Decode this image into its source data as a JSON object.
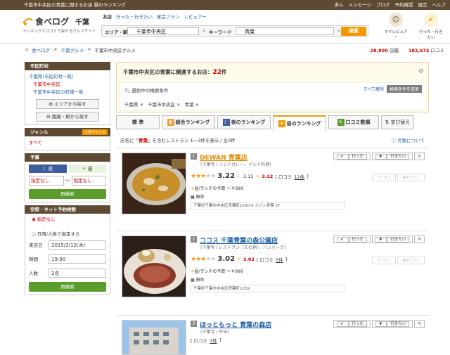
{
  "topbar": {
    "description": "千葉市中央区の青葉に関するお店 昼のランキング",
    "user": "多ム",
    "nav": [
      "メッセージ",
      "ブログ",
      "予約確認",
      "設定",
      "ヘルプ"
    ]
  },
  "logo": {
    "main": "食べログ",
    "area": "千葉",
    "sub": "ランキングと口コミで探せるグルメサイト"
  },
  "search_tabs": [
    "お店",
    "行った・行きたい",
    "宴会プラン",
    "レビュアー"
  ],
  "search": {
    "area_label": "エリア・駅",
    "area_value": "千葉市中央区",
    "keyword_label": "キーワード",
    "keyword_value": "青葉",
    "clear": "×",
    "button": "検索"
  },
  "header_icons": [
    {
      "label": "マイレビュアー",
      "icon": "reviewer-icon"
    },
    {
      "label": "行った・行きたい",
      "icon": "check-icon"
    }
  ],
  "breadcrumb": [
    "食べログ",
    "千葉グルメ",
    "千葉市中央区グルメ"
  ],
  "breadcrumb_sep": ">",
  "counts": {
    "a": "28,800",
    "a_unit": "店舗",
    "b": "182,672",
    "b_unit": "口コミ"
  },
  "sidebar": {
    "area_title": "市区町村",
    "area_items": [
      "千葉県(市区町村一覧)",
      "千葉市中央区",
      "千葉市中央区の町域一覧"
    ],
    "area_btn1": "エリアから探す",
    "area_btn2": "路線・駅から探す",
    "genre_title": "ジャンル",
    "genre_badge": "人気ジャンル",
    "genre_item": "すべて",
    "budget_title": "予算",
    "budget_tabs": [
      "夜",
      "昼"
    ],
    "budget_from": "指定なし",
    "budget_to": "指定なし",
    "budget_sep": "〜",
    "search_btn": "再検索",
    "avail_title": "空席・ネット予約検索",
    "avail_opt1": "指定なし",
    "avail_opt2": "日時/人数で指定する",
    "date_label": "来店日",
    "date_value": "2015/3/12(木)",
    "time_label": "時間",
    "time_value": "19:00",
    "people_label": "人数",
    "people_value": "2名",
    "search_btn2": "再検索"
  },
  "condition": {
    "title_prefix": "千葉市中央区の青葉に関連するお店：",
    "count": "22",
    "title_suffix": "件",
    "current": "選択中の検索条件",
    "clear_all": "すべて解除",
    "change_btn": "検索条件を変更",
    "tags": [
      "千葉県",
      "千葉市中央区",
      "青葉"
    ]
  },
  "tabs": [
    {
      "label": "標 準",
      "icon": ""
    },
    {
      "label": "総合ランキング",
      "icon": "♛"
    },
    {
      "label": "夜のランキング",
      "icon": "☾"
    },
    {
      "label": "昼のランキング",
      "icon": "☀"
    },
    {
      "label": "口コミ数順",
      "icon": "✎"
    },
    {
      "label": "並び替え",
      "icon": "⇅"
    }
  ],
  "summary": {
    "pre": "店名に「",
    "kw": "青葉",
    "post": "」を含むレストラン 1〜3件を表示 / 全3件",
    "right": "点数について"
  },
  "restaurants": [
    {
      "name": "DEWAN 青葉店",
      "num": "1",
      "cat": "(千葉寺 / インドカレー、インド料理)",
      "score": "3.22",
      "score2": "3.13",
      "score3": "3.12",
      "reviews_label": "口コミ",
      "reviews": "12件",
      "budget": "昼/ランチの予算 〜￥999",
      "closed": "無休",
      "addr": "千葉県千葉市中央区青葉町1250-9 メゾン青葉 1F",
      "went": "行った",
      "want": "行きたい",
      "coupon": "クーポン",
      "plan": "宴会プラン",
      "stars": 3
    },
    {
      "name": "ココス 千葉青葉の森公園店",
      "num": "2",
      "cat": "(千葉寺 / レストラン（その他）、ハンバーグ)",
      "score": "3.02",
      "score2": "",
      "score3": "3.02",
      "reviews_label": "口コミ",
      "reviews": "5件",
      "budget": "昼/ランチの予算 〜￥999",
      "closed": "無休",
      "addr": "千葉県千葉市中央区青葉町1259",
      "went": "行った",
      "want": "行きたい",
      "coupon": "クーポン",
      "plan": "宴会プラン",
      "stars": 3
    },
    {
      "name": "ほっともっと 青葉の森店",
      "num": "3",
      "cat": "(千葉寺 / 弁当)",
      "score": "",
      "score2": "",
      "score3": "",
      "reviews_label": "口コミ",
      "reviews": "3件",
      "budget": "",
      "closed": "",
      "addr": "",
      "went": "行った",
      "want": "行きたい",
      "coupon": "",
      "plan": "",
      "stars": 0
    }
  ]
}
